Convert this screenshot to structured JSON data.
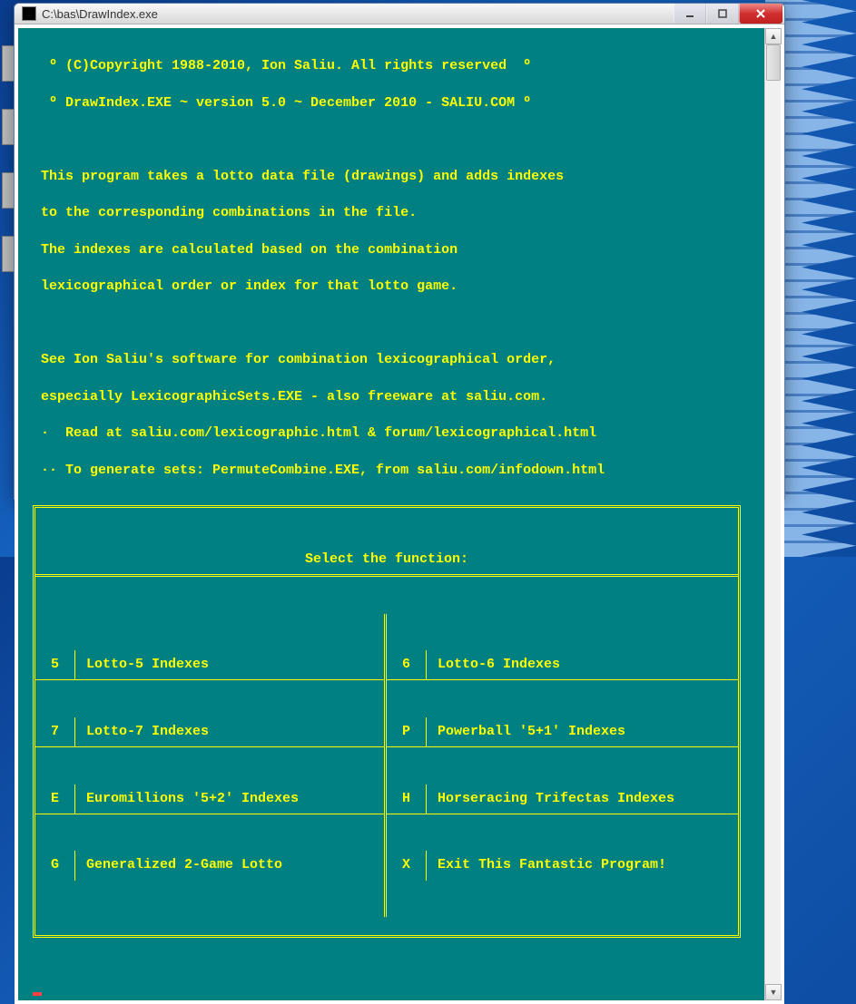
{
  "window": {
    "title": "C:\\bas\\DrawIndex.exe"
  },
  "header": {
    "line1": "  º (C)Copyright 1988-2010, Ion Saliu. All rights reserved  º",
    "line2": "  º DrawIndex.EXE ~ version 5.0 ~ December 2010 - SALIU.COM º"
  },
  "description": {
    "line1": " This program takes a lotto data file (drawings) and adds indexes",
    "line2": " to the corresponding combinations in the file.",
    "line3": " The indexes are calculated based on the combination",
    "line4": " lexicographical order or index for that lotto game.",
    "line5": "",
    "line6": " See Ion Saliu's software for combination lexicographical order,",
    "line7": " especially LexicographicSets.EXE - also freeware at saliu.com.",
    "line8": " ·  Read at saliu.com/lexicographic.html & forum/lexicographical.html",
    "line9": " ·· To generate sets: PermuteCombine.EXE, from saliu.com/infodown.html"
  },
  "menu": {
    "title": "Select the function:",
    "left": [
      {
        "key": "5",
        "label": "Lotto-5 Indexes"
      },
      {
        "key": "7",
        "label": "Lotto-7 Indexes"
      },
      {
        "key": "E",
        "label": "Euromillions '5+2' Indexes"
      },
      {
        "key": "G",
        "label": "Generalized 2-Game Lotto"
      }
    ],
    "right": [
      {
        "key": "6",
        "label": "Lotto-6 Indexes"
      },
      {
        "key": "P",
        "label": "Powerball '5+1' Indexes"
      },
      {
        "key": "H",
        "label": "Horseracing Trifectas Indexes"
      },
      {
        "key": "X",
        "label": "Exit This Fantastic Program!"
      }
    ]
  }
}
